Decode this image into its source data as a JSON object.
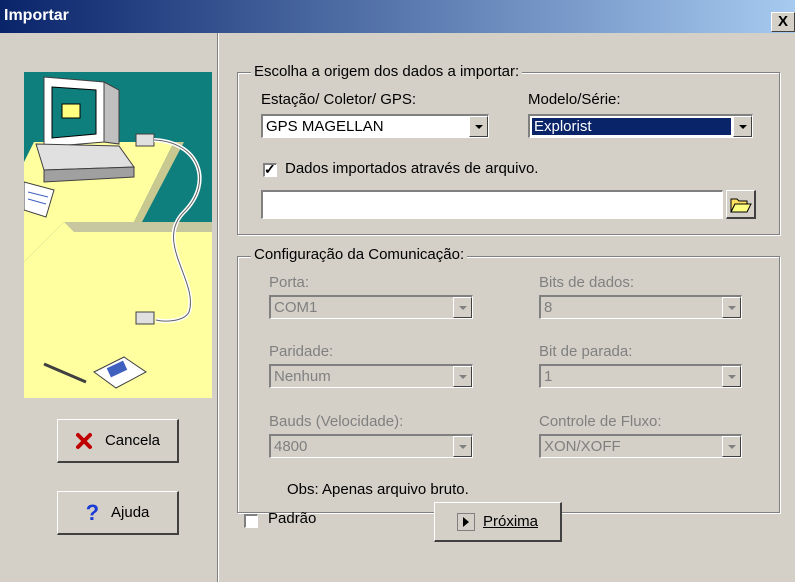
{
  "window": {
    "title": "Importar",
    "close_glyph": "X"
  },
  "left": {
    "illustration_icon": "computer-gps-cable-illustration",
    "cancel_label": "Cancela",
    "cancel_icon": "red-x-icon",
    "help_label": "Ajuda",
    "help_icon": "question-mark-icon"
  },
  "source": {
    "legend": "Escolha a origem dos dados a importar:",
    "station_label": "Estação/ Coletor/ GPS:",
    "station_value": "GPS MAGELLAN",
    "model_label": "Modelo/Série:",
    "model_value": "Explorist",
    "file_checkbox_label": "Dados importados através de arquivo.",
    "file_checkbox_checked": true,
    "file_path": "",
    "browse_icon": "folder-open-icon"
  },
  "comm": {
    "legend": "Configuração da Comunicação:",
    "port_label": "Porta:",
    "port_value": "COM1",
    "databits_label": "Bits de dados:",
    "databits_value": "8",
    "parity_label": "Paridade:",
    "parity_value": "Nenhum",
    "stopbit_label": "Bit de parada:",
    "stopbit_value": "1",
    "baud_label": "Bauds (Velocidade):",
    "baud_value": "4800",
    "flow_label": "Controle de Fluxo:",
    "flow_value": "XON/XOFF",
    "note": "Obs: Apenas arquivo bruto."
  },
  "footer": {
    "default_label": "Padrão",
    "default_checked": false,
    "next_label": "Próxima",
    "next_icon": "play-arrow-icon"
  },
  "colors": {
    "title_start": "#0a246a",
    "title_end": "#a6caf0",
    "face": "#d4d0c8",
    "illus_teal": "#0f7f7d",
    "illus_yellow": "#ffffa0"
  }
}
